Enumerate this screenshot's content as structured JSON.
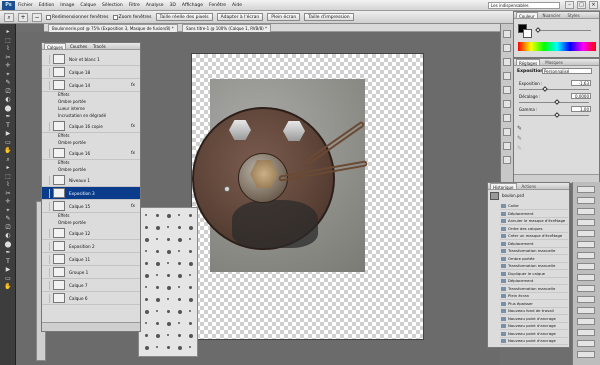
{
  "app": {
    "logo": "Ps",
    "workspace": "Les indispensables"
  },
  "menus": [
    "Fichier",
    "Edition",
    "Image",
    "Calque",
    "Sélection",
    "Filtre",
    "Analyse",
    "3D",
    "Affichage",
    "Fenêtre",
    "Aide"
  ],
  "options": {
    "redimensionner": "Redimensionner fenêtres",
    "zoom": "Zoom fenêtres",
    "pixels_reels": "Taille réelle des pixels",
    "adapter": "Adapter à l'écran",
    "plein_ecran": "Plein écran",
    "impression": "Taille d'impression"
  },
  "document": {
    "tab_label": "Boulonnerie.psd @ 75% (Exposition 3, Masque de fusion/8) *",
    "tab2": "Sans titre-1 @ 100% (Calque 1, RVB/8) *"
  },
  "layers_panel": {
    "tabs": [
      "Calques",
      "Couches",
      "Tracés"
    ],
    "rows": [
      {
        "name": "Noir et blanc 1",
        "fx": false
      },
      {
        "name": "Calque 18",
        "fx": false
      },
      {
        "name": "Calque 14",
        "fx": true
      },
      {
        "name": "Effets",
        "fx": false,
        "sub": true
      },
      {
        "name": "Ombre portée",
        "fx": false,
        "sub": true
      },
      {
        "name": "Lueur interne",
        "fx": false,
        "sub": true
      },
      {
        "name": "Incrustation en dégradé",
        "fx": false,
        "sub": true
      },
      {
        "name": "Calque 16 copie",
        "fx": true
      },
      {
        "name": "Effets",
        "fx": false,
        "sub": true
      },
      {
        "name": "Ombre portée",
        "fx": false,
        "sub": true
      },
      {
        "name": "Calque 16",
        "fx": true
      },
      {
        "name": "Effets",
        "fx": false,
        "sub": true
      },
      {
        "name": "Ombre portée",
        "fx": false,
        "sub": true
      },
      {
        "name": "Niveaux 1",
        "fx": false
      },
      {
        "name": "Exposition 3",
        "fx": false,
        "selected": true
      },
      {
        "name": "Calque 15",
        "fx": true
      },
      {
        "name": "Effets",
        "fx": false,
        "sub": true
      },
      {
        "name": "Ombre portée",
        "fx": false,
        "sub": true
      },
      {
        "name": "Calque 12",
        "fx": false
      },
      {
        "name": "Exposition 2",
        "fx": false
      },
      {
        "name": "Calque 11",
        "fx": false
      },
      {
        "name": "Groupe 1",
        "fx": false
      },
      {
        "name": "Calque 7",
        "fx": false
      },
      {
        "name": "Calque 6",
        "fx": false
      }
    ]
  },
  "color_panel": {
    "tabs": [
      "Couleur",
      "Nuancier",
      "Styles"
    ]
  },
  "adjustments_panel": {
    "tabs": [
      "Réglages",
      "Masques"
    ],
    "title": "Exposition",
    "preset": "Personnalisé",
    "exposition_label": "Exposition :",
    "exposition_value": "-1,63",
    "decalage_label": "Décalage :",
    "decalage_value": "0,0000",
    "gamma_label": "Gamma :",
    "gamma_value": "1,00"
  },
  "history_panel": {
    "tabs": [
      "Historique",
      "Actions"
    ],
    "snapshot": "boulon.psd",
    "items": [
      "Coller",
      "Déplacement",
      "Annuler le masque d'écrêtage",
      "Ordre des calques",
      "Créer un masque d'écrêtage",
      "Déplacement",
      "Transformation manuelle",
      "Ombre portée",
      "Transformation manuelle",
      "Dupliquer le calque",
      "Déplacement",
      "Transformation manuelle",
      "Plein écran",
      "Plus épaisser",
      "Nouveau fond de travail",
      "Nouveau point d'ancrage",
      "Nouveau point d'ancrage",
      "Nouveau point d'ancrage",
      "Nouveau point d'ancrage"
    ]
  },
  "colors": {
    "selection": "#0b3c8c",
    "panel": "#dcdcdc",
    "toolbar": "#3d3d3d"
  }
}
